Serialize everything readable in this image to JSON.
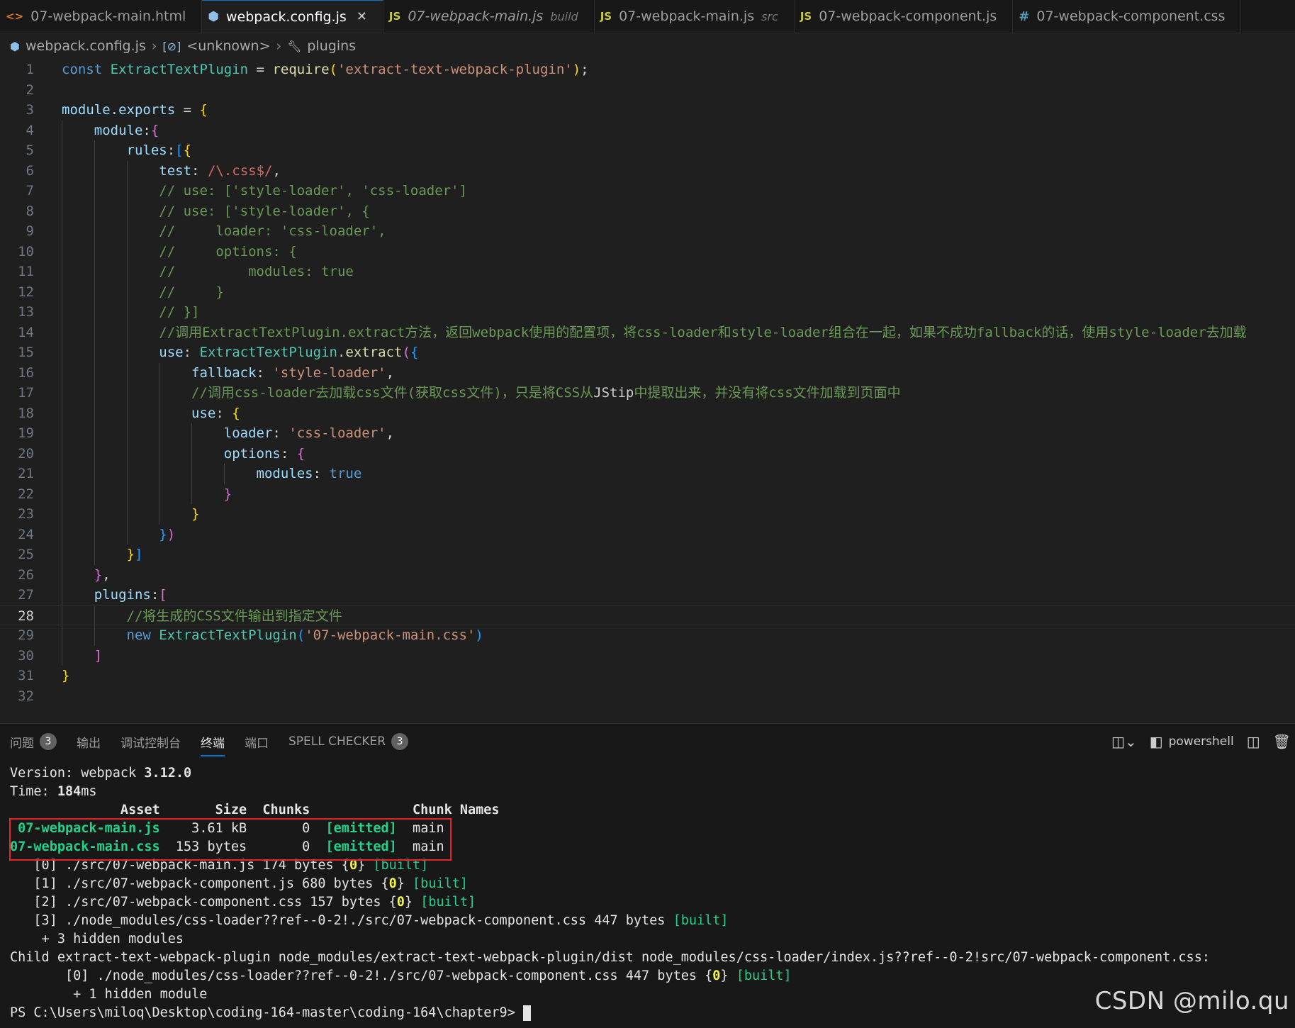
{
  "tabs": [
    {
      "icon": "html",
      "label": "07-webpack-main.html",
      "desc": "",
      "active": false,
      "italic": false
    },
    {
      "icon": "cfg",
      "label": "webpack.config.js",
      "desc": "",
      "active": true,
      "italic": false,
      "close": "✕"
    },
    {
      "icon": "js",
      "label": "07-webpack-main.js",
      "desc": "build",
      "active": false,
      "italic": true
    },
    {
      "icon": "js",
      "label": "07-webpack-main.js",
      "desc": "src",
      "active": false,
      "italic": false
    },
    {
      "icon": "js",
      "label": "07-webpack-component.js",
      "desc": "",
      "active": false,
      "italic": false
    },
    {
      "icon": "css",
      "label": "07-webpack-component.css",
      "desc": "",
      "active": false,
      "italic": false
    }
  ],
  "breadcrumb": {
    "file": "webpack.config.js",
    "symbol": "<unknown>",
    "prop": "plugins"
  },
  "editor": {
    "current_line": 28,
    "lines": [
      [
        [
          "kw",
          "const "
        ],
        [
          "cls",
          "ExtractTextPlugin"
        ],
        [
          "op",
          " = "
        ],
        [
          "fn",
          "require"
        ],
        [
          "p1",
          "("
        ],
        [
          "str",
          "'extract-text-webpack-plugin'"
        ],
        [
          "p1",
          ")"
        ],
        [
          "op",
          ";"
        ]
      ],
      [],
      [
        [
          "prop",
          "module"
        ],
        [
          "op",
          "."
        ],
        [
          "prop",
          "exports"
        ],
        [
          "op",
          " = "
        ],
        [
          "p1",
          "{"
        ]
      ],
      [
        [
          "txt",
          "    "
        ],
        [
          "prop",
          "module"
        ],
        [
          "op",
          ":"
        ],
        [
          "p2",
          "{"
        ]
      ],
      [
        [
          "txt",
          "        "
        ],
        [
          "prop",
          "rules"
        ],
        [
          "op",
          ":"
        ],
        [
          "p3",
          "["
        ],
        [
          "p1",
          "{"
        ]
      ],
      [
        [
          "txt",
          "            "
        ],
        [
          "prop",
          "test"
        ],
        [
          "op",
          ": "
        ],
        [
          "re",
          "/\\.css$/"
        ],
        [
          "op",
          ","
        ]
      ],
      [
        [
          "txt",
          "            "
        ],
        [
          "cmt",
          "// use: ['style-loader', 'css-loader']"
        ]
      ],
      [
        [
          "txt",
          "            "
        ],
        [
          "cmt",
          "// use: ['style-loader', {"
        ]
      ],
      [
        [
          "txt",
          "            "
        ],
        [
          "cmt",
          "//     loader: 'css-loader',"
        ]
      ],
      [
        [
          "txt",
          "            "
        ],
        [
          "cmt",
          "//     options: {"
        ]
      ],
      [
        [
          "txt",
          "            "
        ],
        [
          "cmt",
          "//         modules: true"
        ]
      ],
      [
        [
          "txt",
          "            "
        ],
        [
          "cmt",
          "//     }"
        ]
      ],
      [
        [
          "txt",
          "            "
        ],
        [
          "cmt",
          "// }]"
        ]
      ],
      [
        [
          "txt",
          "            "
        ],
        [
          "cmt",
          "//调用ExtractTextPlugin.extract方法，返回webpack使用的配置项，将css-loader和style-loader组合在一起，如果不成功fallback的话，使用style-loader去加载"
        ]
      ],
      [
        [
          "txt",
          "            "
        ],
        [
          "prop",
          "use"
        ],
        [
          "op",
          ": "
        ],
        [
          "cls",
          "ExtractTextPlugin"
        ],
        [
          "op",
          "."
        ],
        [
          "fn",
          "extract"
        ],
        [
          "p2",
          "("
        ],
        [
          "p3",
          "{"
        ]
      ],
      [
        [
          "txt",
          "                "
        ],
        [
          "prop",
          "fallback"
        ],
        [
          "op",
          ": "
        ],
        [
          "str",
          "'style-loader'"
        ],
        [
          "op",
          ","
        ]
      ],
      [
        [
          "txt",
          "                "
        ],
        [
          "cmt",
          "//调用css-loader去加载css文件(获取css文件)，只是将CSS从"
        ],
        [
          "squig",
          "JStip"
        ],
        [
          "cmt",
          "中提取出来，并没有将css文件加载到页面中"
        ]
      ],
      [
        [
          "txt",
          "                "
        ],
        [
          "prop",
          "use"
        ],
        [
          "op",
          ": "
        ],
        [
          "p1",
          "{"
        ]
      ],
      [
        [
          "txt",
          "                    "
        ],
        [
          "prop",
          "loader"
        ],
        [
          "op",
          ": "
        ],
        [
          "str",
          "'css-loader'"
        ],
        [
          "op",
          ","
        ]
      ],
      [
        [
          "txt",
          "                    "
        ],
        [
          "prop",
          "options"
        ],
        [
          "op",
          ": "
        ],
        [
          "p2",
          "{"
        ]
      ],
      [
        [
          "txt",
          "                        "
        ],
        [
          "prop",
          "modules"
        ],
        [
          "op",
          ": "
        ],
        [
          "kw",
          "true"
        ]
      ],
      [
        [
          "txt",
          "                    "
        ],
        [
          "p2",
          "}"
        ]
      ],
      [
        [
          "txt",
          "                "
        ],
        [
          "p1",
          "}"
        ]
      ],
      [
        [
          "txt",
          "            "
        ],
        [
          "p3",
          "}"
        ],
        [
          "p2",
          ")"
        ]
      ],
      [
        [
          "txt",
          "        "
        ],
        [
          "p1",
          "}"
        ],
        [
          "p3",
          "]"
        ]
      ],
      [
        [
          "txt",
          "    "
        ],
        [
          "p2",
          "}"
        ],
        [
          "op",
          ","
        ]
      ],
      [
        [
          "txt",
          "    "
        ],
        [
          "prop",
          "plugins"
        ],
        [
          "op",
          ":"
        ],
        [
          "p2",
          "["
        ]
      ],
      [
        [
          "txt",
          "        "
        ],
        [
          "cmt",
          "//将生成的CSS文件输出到指定文件"
        ]
      ],
      [
        [
          "txt",
          "        "
        ],
        [
          "kw",
          "new "
        ],
        [
          "cls",
          "ExtractTextPlugin"
        ],
        [
          "p3",
          "("
        ],
        [
          "str",
          "'07-webpack-main.css'"
        ],
        [
          "p3",
          ")"
        ]
      ],
      [
        [
          "txt",
          "    "
        ],
        [
          "p2",
          "]"
        ]
      ],
      [
        [
          "p1",
          "}"
        ]
      ],
      []
    ]
  },
  "panel": {
    "tabs": [
      {
        "label": "问题",
        "badge": "3",
        "active": false
      },
      {
        "label": "输出",
        "badge": "",
        "active": false
      },
      {
        "label": "调试控制台",
        "badge": "",
        "active": false
      },
      {
        "label": "终端",
        "badge": "",
        "active": true
      },
      {
        "label": "端口",
        "badge": "",
        "active": false
      },
      {
        "label": "SPELL CHECKER",
        "badge": "3",
        "active": false
      }
    ],
    "shell_label": "powershell"
  },
  "terminal": {
    "lines": [
      [
        [
          "w",
          "Version: webpack "
        ],
        [
          "hb",
          "3.12.0"
        ]
      ],
      [
        [
          "w",
          "Time: "
        ],
        [
          "hb",
          "184"
        ],
        [
          "w",
          "ms"
        ]
      ],
      [
        [
          "hb",
          "              Asset       Size  Chunks             Chunk Names"
        ]
      ],
      [
        [
          "g",
          " 07-webpack-main.js"
        ],
        [
          "w",
          "    3.61 kB       0  "
        ],
        [
          "g",
          "[emitted]"
        ],
        [
          "w",
          "  main"
        ]
      ],
      [
        [
          "g",
          "07-webpack-main.css"
        ],
        [
          "w",
          "  153 bytes       0  "
        ],
        [
          "g",
          "[emitted]"
        ],
        [
          "w",
          "  main"
        ]
      ],
      [
        [
          "w",
          "   [0] ./src/07-webpack-main.js 174 bytes {"
        ],
        [
          "yb",
          "0"
        ],
        [
          "w",
          "} "
        ],
        [
          "gn",
          "[built]"
        ]
      ],
      [
        [
          "w",
          "   [1] ./src/07-webpack-component.js 680 bytes {"
        ],
        [
          "yb",
          "0"
        ],
        [
          "w",
          "} "
        ],
        [
          "gn",
          "[built]"
        ]
      ],
      [
        [
          "w",
          "   [2] ./src/07-webpack-component.css 157 bytes {"
        ],
        [
          "yb",
          "0"
        ],
        [
          "w",
          "} "
        ],
        [
          "gn",
          "[built]"
        ]
      ],
      [
        [
          "w",
          "   [3] ./node_modules/css-loader??ref--0-2!./src/07-webpack-component.css 447 bytes "
        ],
        [
          "gn",
          "[built]"
        ]
      ],
      [
        [
          "w",
          "    + 3 hidden modules"
        ]
      ],
      [
        [
          "w",
          "Child extract-text-webpack-plugin node_modules/extract-text-webpack-plugin/dist node_modules/css-loader/index.js??ref--0-2!src/07-webpack-component.css:"
        ]
      ],
      [
        [
          "w",
          "       [0] ./node_modules/css-loader??ref--0-2!./src/07-webpack-component.css 447 bytes {"
        ],
        [
          "yb",
          "0"
        ],
        [
          "w",
          "} "
        ],
        [
          "gn",
          "[built]"
        ]
      ],
      [
        [
          "w",
          "        + 1 hidden module"
        ]
      ],
      [
        [
          "w",
          "PS C:\\Users\\miloq\\Desktop\\coding-164-master\\coding-164\\chapter9> "
        ]
      ]
    ]
  },
  "watermark": "CSDN @milo.qu"
}
